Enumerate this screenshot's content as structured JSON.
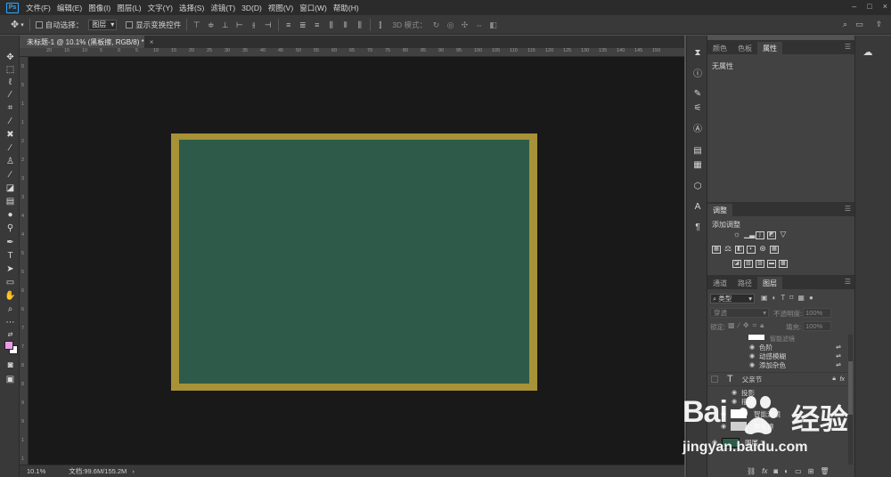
{
  "app": {
    "logo": "Ps"
  },
  "menu": [
    "文件(F)",
    "编辑(E)",
    "图像(I)",
    "图层(L)",
    "文字(Y)",
    "选择(S)",
    "滤镜(T)",
    "3D(D)",
    "视图(V)",
    "窗口(W)",
    "帮助(H)"
  ],
  "window_controls": {
    "minimize": "–",
    "restore": "□",
    "close": "×"
  },
  "options_bar": {
    "auto_select_label": "自动选择：",
    "auto_select_value": "图层",
    "show_transform_label": "显示变换控件",
    "mode_3d_label": "3D 模式："
  },
  "document_tab": {
    "title": "未标题-1 @ 10.1% (黑板擦, RGB/8) *",
    "close": "×"
  },
  "rulers": {
    "h_ticks": [
      "20",
      "15",
      "10",
      "5",
      "0",
      "5",
      "10",
      "15",
      "20",
      "25",
      "30",
      "35",
      "40",
      "45",
      "50",
      "55",
      "60",
      "65",
      "70",
      "75",
      "80",
      "85",
      "90",
      "95",
      "100",
      "105",
      "110",
      "115",
      "120",
      "125",
      "130",
      "135",
      "140",
      "145",
      "150"
    ],
    "v_ticks": [
      "0",
      "5",
      "1",
      "1",
      "2",
      "2",
      "3",
      "3",
      "4",
      "4",
      "5",
      "5",
      "6",
      "6",
      "7",
      "7",
      "8",
      "8",
      "9",
      "9",
      "1",
      "1"
    ]
  },
  "status_bar": {
    "zoom": "10.1%",
    "doc_info": "文档:99.6M/155.2M",
    "arrow": "›"
  },
  "panel_top": {
    "tabs": [
      "颜色",
      "色板",
      "属性"
    ],
    "active_tab": "属性",
    "content": "无属性"
  },
  "panel_adjust": {
    "tab": "调整",
    "header": "添加调整"
  },
  "panel_layers": {
    "tabs": [
      "通道",
      "路径",
      "图层"
    ],
    "active_tab": "图层",
    "filter_kind": "类型",
    "blend_mode": "穿透",
    "opacity_label": "不透明度:",
    "opacity_value": "100%",
    "lock_label": "锁定:",
    "fill_label": "填充:",
    "fill_value": "100%",
    "rows": [
      {
        "name": "智能滤镜",
        "type": "filter-header"
      },
      {
        "name": "色阶",
        "type": "filter"
      },
      {
        "name": "动感模糊",
        "type": "filter"
      },
      {
        "name": "添加杂色",
        "type": "filter"
      },
      {
        "name": "父亲节",
        "type": "text"
      },
      {
        "name": "投影",
        "type": "effect"
      },
      {
        "name": "描边",
        "type": "effect"
      },
      {
        "name": "智能滤镜",
        "type": "smart"
      },
      {
        "name": "黑板擦",
        "type": "smart"
      },
      {
        "name": "图层 1",
        "type": "layer"
      }
    ]
  },
  "watermark": {
    "brand_left": "Bai",
    "brand_right": "经验",
    "url": "jingyan.baidu.com"
  },
  "colors": {
    "menubar_bg": "#2b2b2b",
    "panel_bg": "#424242",
    "canvas_bg": "#191919",
    "board_frame": "#a79238",
    "board_green": "#2e5b49",
    "foreground_swatch": "#e99be6",
    "background_swatch": "#ffffff",
    "accent_ps": "#31a8ff"
  }
}
